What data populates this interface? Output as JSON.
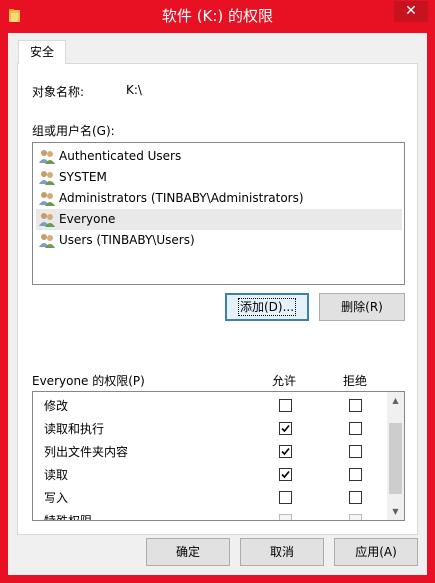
{
  "window": {
    "title": "软件 (K:) 的权限",
    "close_glyph": "✕"
  },
  "tabs": [
    {
      "label": "安全",
      "active": true
    }
  ],
  "object": {
    "label": "对象名称:",
    "value": "K:\\"
  },
  "groups": {
    "label": "组或用户名(G):",
    "items": [
      {
        "label": "Authenticated Users",
        "selected": false,
        "icon": "users-icon"
      },
      {
        "label": "SYSTEM",
        "selected": false,
        "icon": "users-icon"
      },
      {
        "label": "Administrators (TINBABY\\Administrators)",
        "selected": false,
        "icon": "users-icon"
      },
      {
        "label": "Everyone",
        "selected": true,
        "icon": "users-icon"
      },
      {
        "label": "Users (TINBABY\\Users)",
        "selected": false,
        "icon": "users-icon"
      }
    ]
  },
  "buttons": {
    "add": "添加(D)...",
    "remove": "删除(R)",
    "ok": "确定",
    "cancel": "取消",
    "apply": "应用(A)"
  },
  "permissions": {
    "label": "Everyone 的权限(P)",
    "allow_header": "允许",
    "deny_header": "拒绝",
    "rows": [
      {
        "label": "修改",
        "allow": false,
        "deny": false
      },
      {
        "label": "读取和执行",
        "allow": true,
        "deny": false
      },
      {
        "label": "列出文件夹内容",
        "allow": true,
        "deny": false
      },
      {
        "label": "读取",
        "allow": true,
        "deny": false
      },
      {
        "label": "写入",
        "allow": false,
        "deny": false
      },
      {
        "label": "特殊权限",
        "allow": false,
        "deny": false,
        "disabled": true
      }
    ]
  },
  "colors": {
    "titlebar": "#e81123",
    "selection": "#e9e9e9"
  }
}
